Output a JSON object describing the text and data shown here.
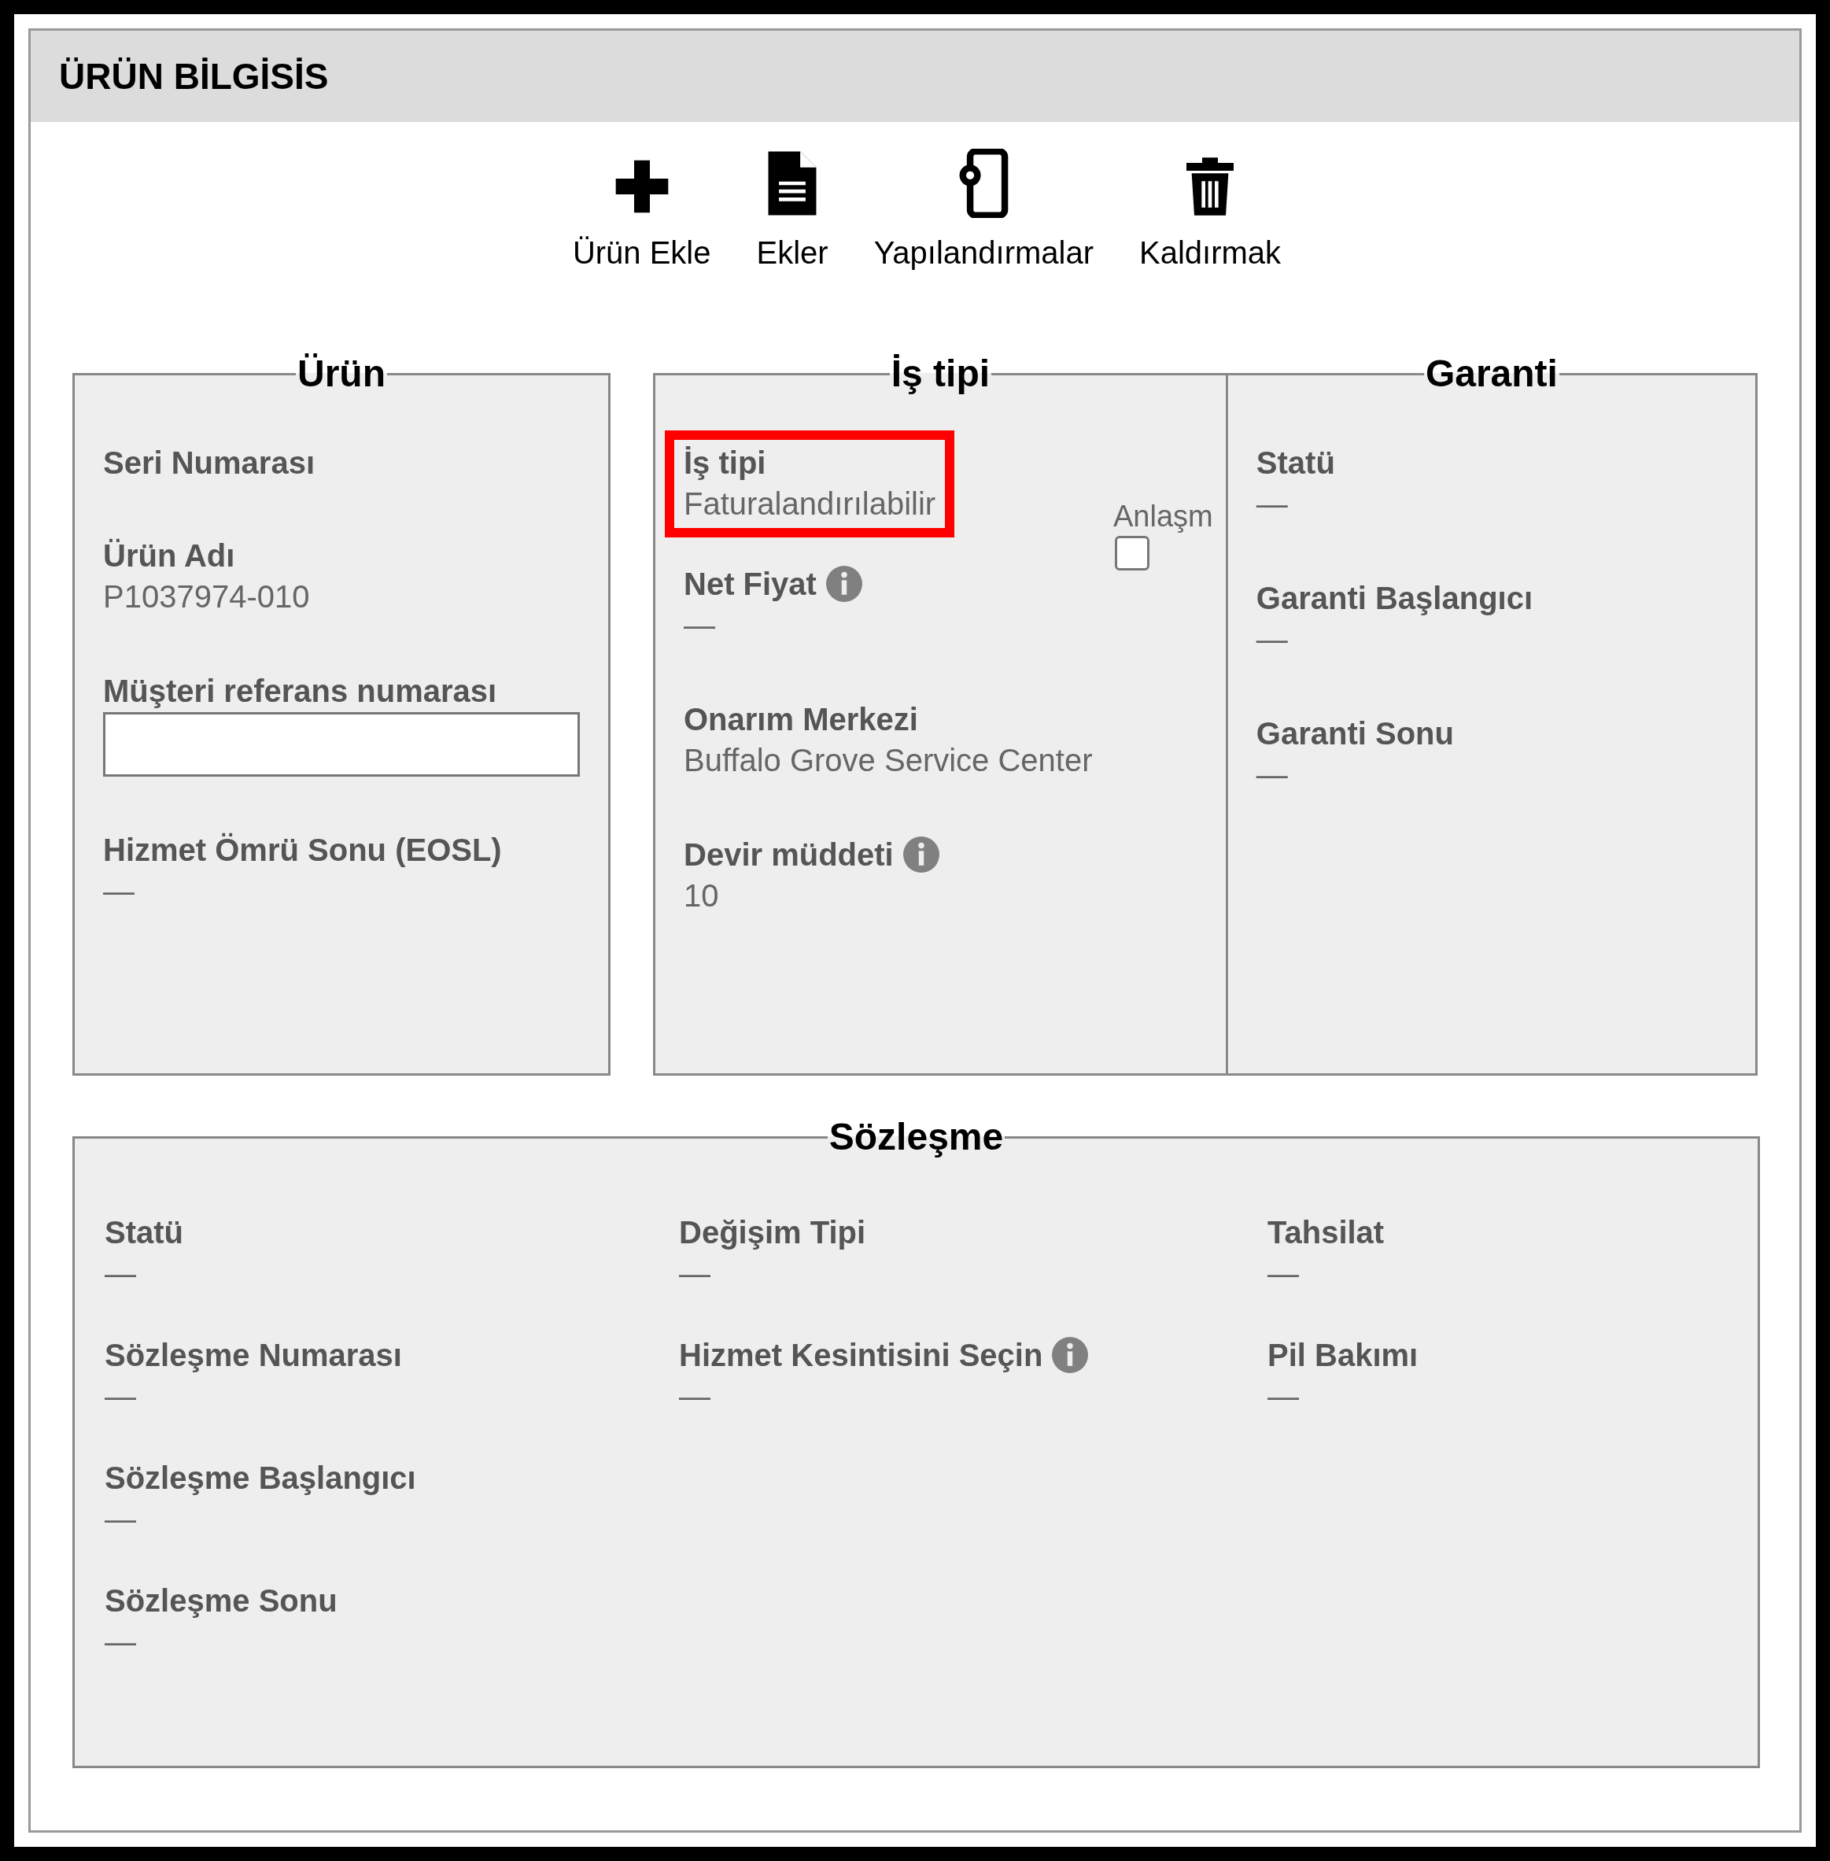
{
  "header": {
    "title": "ÜRÜN BİLGİSİS"
  },
  "toolbar": [
    {
      "kind": "plus",
      "label": "Ürün Ekle"
    },
    {
      "kind": "document",
      "label": "Ekler"
    },
    {
      "kind": "device",
      "label": "Yapılandırmalar"
    },
    {
      "kind": "trash",
      "label": "Kaldırmak"
    }
  ],
  "product": {
    "legend": "Ürün",
    "fields": [
      {
        "kind": "text",
        "label": "Seri Numarası"
      },
      {
        "kind": "text",
        "label": "Ürün Adı",
        "value": "P1037974-010"
      },
      {
        "kind": "input",
        "label": "Müşteri referans numarası"
      },
      {
        "kind": "text",
        "label": "Hizmet Ömrü Sonu (EOSL)",
        "value": "—"
      }
    ]
  },
  "business": {
    "legend": "İş tipi",
    "checkbox": {
      "label": "Anlaşm",
      "checked": false
    },
    "fields": [
      {
        "label": "İş tipi",
        "value": "Faturalandırılabilir",
        "highlighted": true
      },
      {
        "label": "Net Fiyat",
        "value": "—",
        "info": true
      },
      {
        "label": "Onarım Merkezi",
        "value": "Buffalo Grove Service Center"
      },
      {
        "label": "Devir müddeti",
        "value": "10",
        "info": true
      }
    ]
  },
  "warranty": {
    "legend": "Garanti",
    "fields": [
      {
        "label": "Statü",
        "value": "—"
      },
      {
        "label": "Garanti Başlangıcı",
        "value": "—"
      },
      {
        "label": "Garanti Sonu",
        "value": "—"
      }
    ]
  },
  "contract": {
    "legend": "Sözleşme",
    "columns": [
      [
        {
          "label": "Statü",
          "value": "—"
        },
        {
          "label": "Sözleşme Numarası",
          "value": "—"
        },
        {
          "label": "Sözleşme Başlangıcı",
          "value": "—"
        },
        {
          "label": "Sözleşme Sonu",
          "value": "—"
        }
      ],
      [
        {
          "label": "Değişim Tipi",
          "value": "—"
        },
        {
          "label": "Hizmet Kesintisini Seçin",
          "value": "—",
          "info": true
        }
      ],
      [
        {
          "label": "Tahsilat",
          "value": "—"
        },
        {
          "label": "Pil Bakımı",
          "value": "—"
        }
      ]
    ]
  }
}
